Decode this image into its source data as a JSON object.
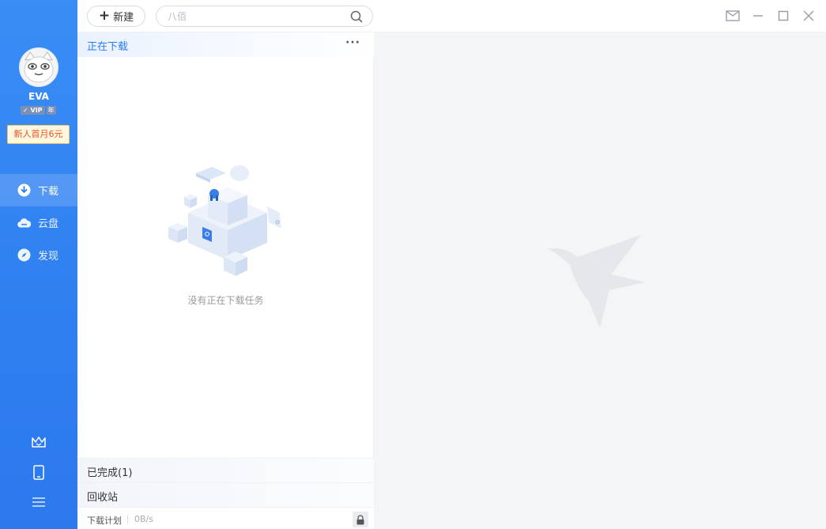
{
  "sidebar": {
    "username": "EVA",
    "vip_label": "VIP",
    "year_label": "年",
    "promo": "新人首月6元",
    "nav": [
      {
        "label": "下载",
        "icon": "download-icon",
        "active": true
      },
      {
        "label": "云盘",
        "icon": "cloud-icon",
        "active": false
      },
      {
        "label": "发现",
        "icon": "compass-icon",
        "active": false
      }
    ],
    "bottom_icons": [
      "crown-icon",
      "phone-icon",
      "menu-icon"
    ]
  },
  "toolbar": {
    "new_label": "新建",
    "search_placeholder": "八佰"
  },
  "list": {
    "downloading_title": "正在下载",
    "more_label": "···",
    "empty_text": "没有正在下载任务",
    "completed_label": "已完成(1)",
    "recycle_label": "回收站",
    "plan_label": "下载计划",
    "speed": "0B/s"
  },
  "colors": {
    "accent": "#2b7bf0",
    "sidebar": "#2f7ff0",
    "promo_text": "#e8541f",
    "detail_bg": "#f4f5f7"
  }
}
